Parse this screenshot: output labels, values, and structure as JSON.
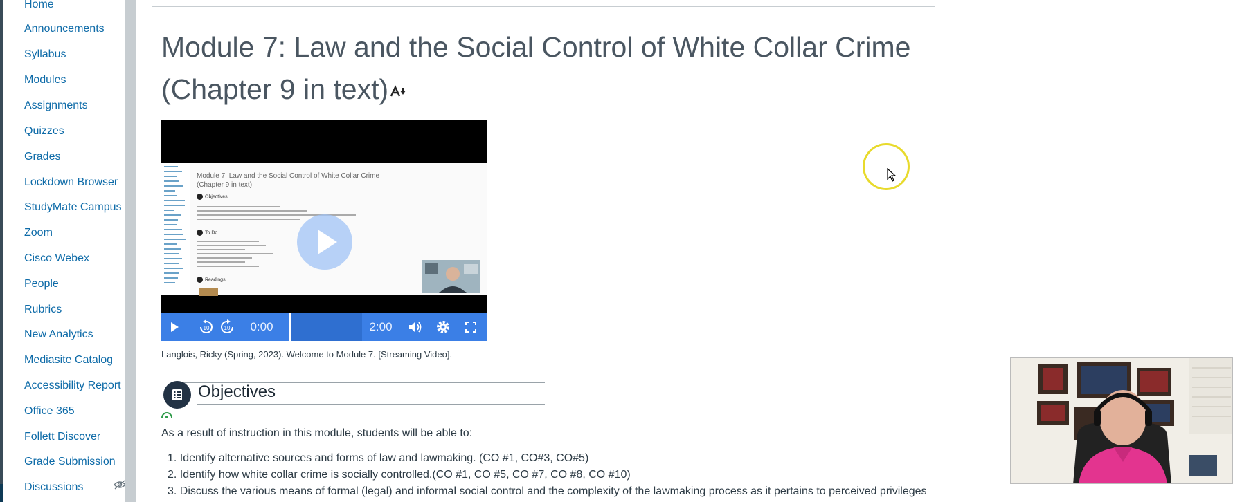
{
  "sidebar": {
    "items": [
      {
        "label": "Home"
      },
      {
        "label": "Announcements"
      },
      {
        "label": "Syllabus"
      },
      {
        "label": "Modules"
      },
      {
        "label": "Assignments"
      },
      {
        "label": "Quizzes"
      },
      {
        "label": "Grades"
      },
      {
        "label": "Lockdown Browser"
      },
      {
        "label": "StudyMate Campus"
      },
      {
        "label": "Zoom"
      },
      {
        "label": "Cisco Webex"
      },
      {
        "label": "People"
      },
      {
        "label": "Rubrics"
      },
      {
        "label": "New Analytics"
      },
      {
        "label": "Mediasite Catalog"
      },
      {
        "label": "Accessibility Report"
      },
      {
        "label": "Office 365"
      },
      {
        "label": "Follett Discover"
      },
      {
        "label": "Grade Submission"
      },
      {
        "label": "Discussions"
      }
    ],
    "discussions_hidden_icon": "eye-slash-icon"
  },
  "page": {
    "title_line1": "Module 7: Law and the Social Control of White Collar Crime",
    "title_line2": "(Chapter 9 in text)",
    "title_icon": "accessibility-text-icon"
  },
  "video": {
    "thumbnail_title": "Module 7: Law and the Social Control of White Collar Crime",
    "thumbnail_subtitle": "(Chapter 9 in text)",
    "thumbnail_objectives": "Objectives",
    "thumbnail_todo": "To Do",
    "thumbnail_readings": "Readings",
    "current_time": "0:00",
    "duration": "2:00",
    "icons": {
      "play": "play-icon",
      "rewind": "rewind-10-icon",
      "forward": "forward-10-icon",
      "volume": "volume-icon",
      "settings": "gear-icon",
      "fullscreen": "fullscreen-icon",
      "big_play": "play-overlay-icon"
    }
  },
  "caption": "Langlois, Ricky (Spring, 2023). Welcome to Module 7. [Streaming Video].",
  "objectives": {
    "heading": "Objectives",
    "icon": "list-icon",
    "intro": "As a result of instruction in this module, students will be able to:",
    "items": [
      "1. Identify alternative sources and forms of law and lawmaking. (CO #1, CO#3, CO#5)",
      "2. Identify how white collar crime is socially controlled.(CO #1, CO #5, CO #7, CO #8, CO #10)",
      "3. Discuss the various means of formal (legal) and informal social control and the complexity of the lawmaking process as it pertains to perceived privileges"
    ]
  },
  "colors": {
    "link": "#0e6ba8",
    "video_controls": "#3b7fe6",
    "cursor_highlight": "#e8da2c"
  }
}
